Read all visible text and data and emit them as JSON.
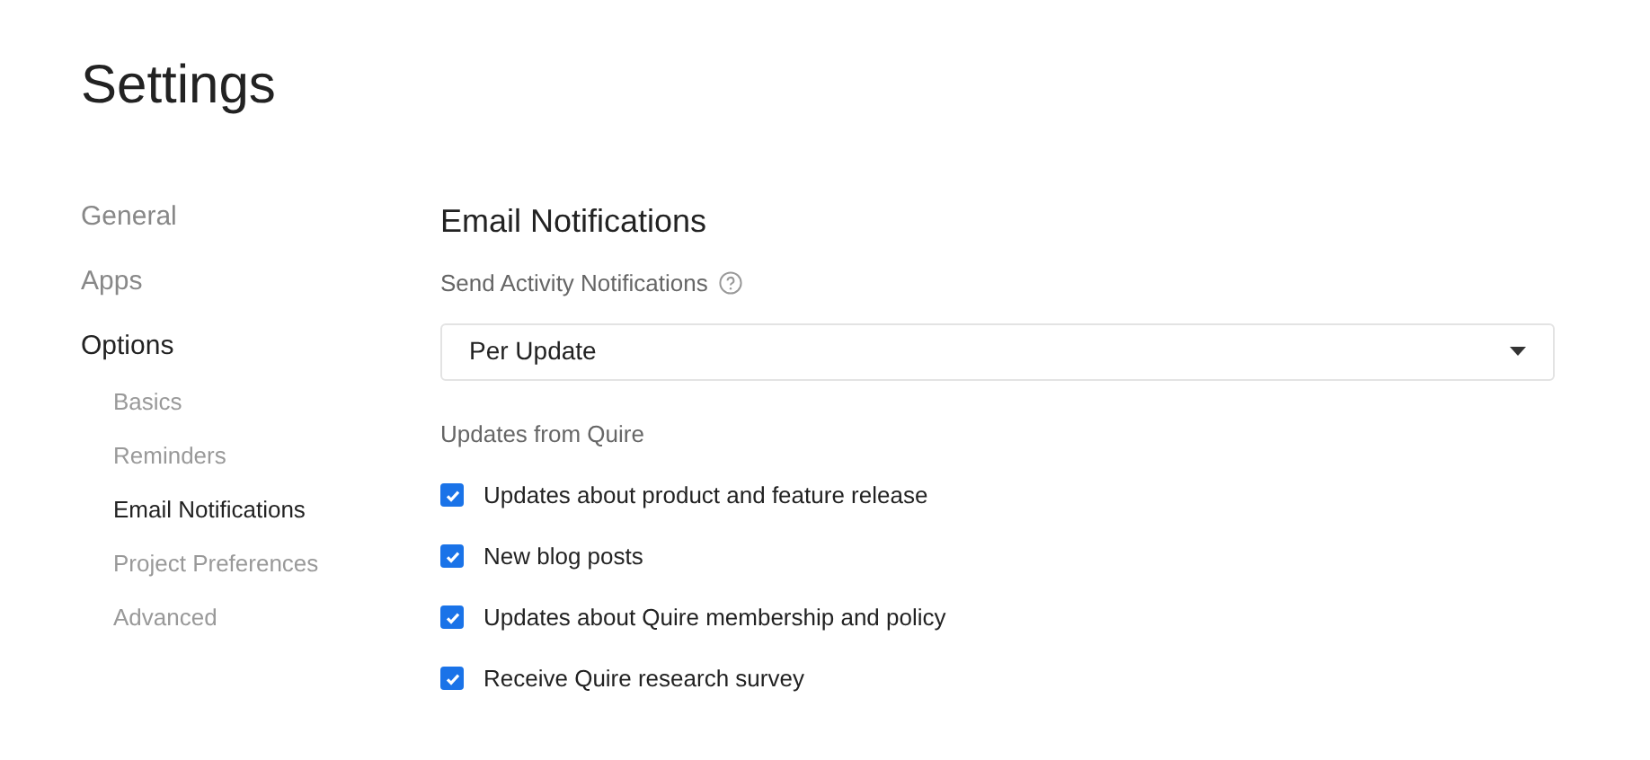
{
  "page_title": "Settings",
  "sidebar": {
    "items": [
      {
        "label": "General",
        "selected": false
      },
      {
        "label": "Apps",
        "selected": false
      },
      {
        "label": "Options",
        "selected": true,
        "children": [
          {
            "label": "Basics",
            "selected": false
          },
          {
            "label": "Reminders",
            "selected": false
          },
          {
            "label": "Email Notifications",
            "selected": true
          },
          {
            "label": "Project Preferences",
            "selected": false
          },
          {
            "label": "Advanced",
            "selected": false
          }
        ]
      }
    ]
  },
  "section": {
    "title": "Email Notifications",
    "activity_label": "Send Activity Notifications",
    "activity_select": {
      "value": "Per Update"
    },
    "updates_label": "Updates from Quire",
    "options": [
      {
        "label": "Updates about product and feature release",
        "checked": true
      },
      {
        "label": "New blog posts",
        "checked": true
      },
      {
        "label": "Updates about Quire membership and policy",
        "checked": true
      },
      {
        "label": "Receive Quire research survey",
        "checked": true
      }
    ]
  }
}
